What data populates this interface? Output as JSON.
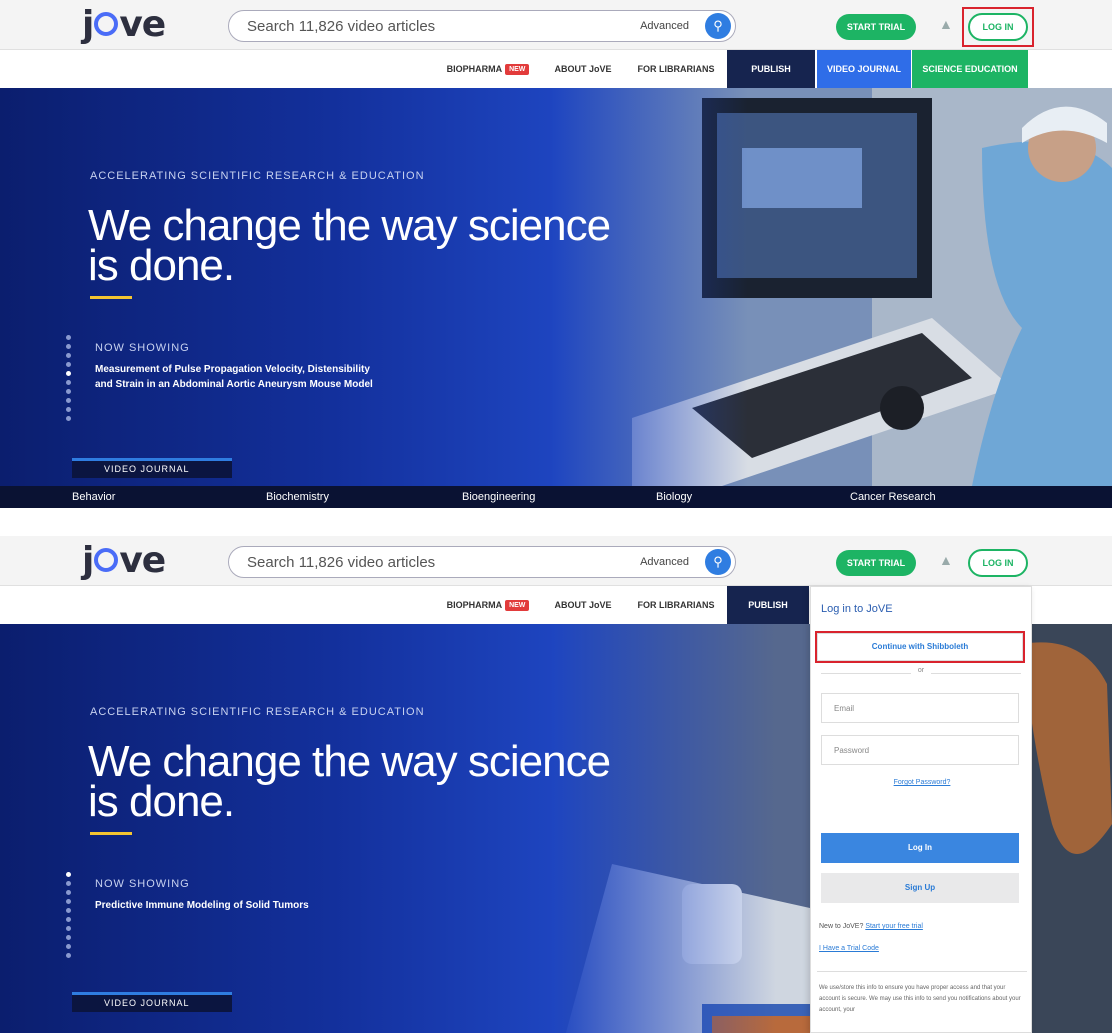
{
  "header": {
    "logo_text": "jove",
    "search_placeholder": "Search 11,826 video articles",
    "advanced_label": "Advanced",
    "start_trial_label": "START TRIAL",
    "login_label": "LOG IN"
  },
  "nav": {
    "biopharma": "BIOPHARMA",
    "new_badge": "NEW",
    "about": "ABOUT JoVE",
    "librarians": "FOR LIBRARIANS",
    "publish": "PUBLISH",
    "video_journal": "VIDEO JOURNAL",
    "science_education": "SCIENCE EDUCATION"
  },
  "hero": {
    "kicker": "ACCELERATING SCIENTIFIC RESEARCH & EDUCATION",
    "headline": "We change the way science is done.",
    "now_showing_label": "NOW SHOWING",
    "video_journal_tab": "VIDEO JOURNAL"
  },
  "panel1": {
    "featured_title": "Measurement of Pulse Propagation Velocity, Distensibility and Strain in an Abdominal Aortic Aneurysm Mouse Model",
    "categories": [
      "Behavior",
      "Biochemistry",
      "Bioengineering",
      "Biology",
      "Cancer Research"
    ]
  },
  "panel2": {
    "featured_title": "Predictive Immune Modeling of Solid Tumors"
  },
  "login_dropdown": {
    "title": "Log in to JoVE",
    "shibboleth_label": "Continue with Shibboleth",
    "or_label": "or",
    "email_placeholder": "Email",
    "password_placeholder": "Password",
    "forgot_label": "Forgot Password?",
    "login_button": "Log In",
    "signup_button": "Sign Up",
    "new_to_text": "New to JoVE?",
    "start_trial_link": "Start your free trial",
    "trial_code_link": "I Have a Trial Code",
    "privacy_text": "We use/store this info to ensure you have proper access and that your account is secure. We may use this info to send you notifications about your account, your"
  },
  "colors": {
    "accent_blue": "#2f7de1",
    "green": "#1db464",
    "highlight_red": "#d9232d",
    "hero_navy": "#0b1e6e"
  }
}
